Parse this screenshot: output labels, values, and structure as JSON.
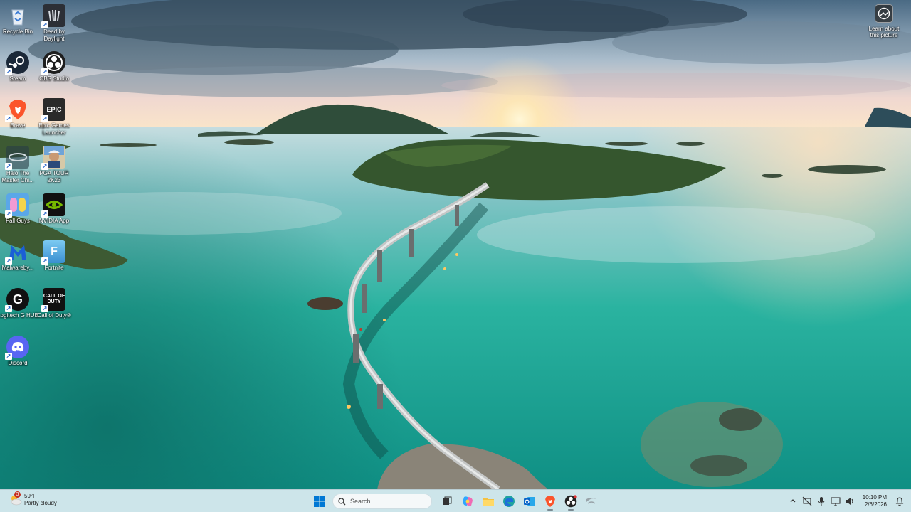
{
  "desktop": {
    "icons": [
      {
        "label": "Recycle Bin",
        "icon": "recycle-bin-icon"
      },
      {
        "label": "Dead by Daylight",
        "icon": "dead-by-daylight-icon"
      },
      {
        "label": "Steam",
        "icon": "steam-icon"
      },
      {
        "label": "OBS Studio",
        "icon": "obs-studio-icon"
      },
      {
        "label": "Brave",
        "icon": "brave-icon"
      },
      {
        "label": "Epic Games Launcher",
        "icon": "epic-games-icon",
        "tile_text": "EPIC"
      },
      {
        "label": "Halo The Master Chi...",
        "icon": "halo-icon"
      },
      {
        "label": "PGA TOUR 2K23",
        "icon": "pga-tour-icon"
      },
      {
        "label": "Fall Guys",
        "icon": "fall-guys-icon"
      },
      {
        "label": "NVIDIA App",
        "icon": "nvidia-icon"
      },
      {
        "label": "Malwareby...",
        "icon": "malwarebytes-icon"
      },
      {
        "label": "Fortnite",
        "icon": "fortnite-icon",
        "tile_text": "F"
      },
      {
        "label": "Logitech G HUB",
        "icon": "logitech-g-hub-icon",
        "tile_text": "G"
      },
      {
        "label": "Call of Duty®",
        "icon": "call-of-duty-icon",
        "tile_text": "CALL OF DUTY"
      },
      {
        "label": "Discord",
        "icon": "discord-icon"
      }
    ],
    "learn_picture": {
      "label": "Learn about this picture",
      "icon": "learn-about-picture-icon"
    }
  },
  "taskbar": {
    "weather": {
      "temp": "59°F",
      "condition": "Partly cloudy",
      "badge": "3",
      "icon": "weather-sun-cloud-icon"
    },
    "search": {
      "placeholder": "Search",
      "icon": "search-icon"
    },
    "pinned": [
      {
        "name": "start-button",
        "icon": "windows-logo-icon"
      },
      {
        "name": "task-view",
        "icon": "task-view-icon"
      },
      {
        "name": "copilot",
        "icon": "copilot-icon"
      },
      {
        "name": "file-explorer",
        "icon": "folder-icon"
      },
      {
        "name": "edge",
        "icon": "edge-icon"
      },
      {
        "name": "outlook",
        "icon": "outlook-icon"
      },
      {
        "name": "brave",
        "icon": "brave-icon"
      },
      {
        "name": "obs",
        "icon": "obs-studio-icon"
      },
      {
        "name": "steam",
        "icon": "steam-icon"
      }
    ],
    "tray": {
      "icons": [
        "chevron-up-icon",
        "network-off-icon",
        "microphone-icon",
        "display-icon",
        "volume-icon"
      ],
      "time": "10:10 PM",
      "date": "2/6/2026",
      "notification_icon": "notification-bell-icon"
    }
  },
  "colors": {
    "taskbar_bg": "#d4e8ee",
    "accent_blue": "#0067c0",
    "brave_orange": "#fb542b",
    "nvidia_green": "#76b900",
    "discord_blurple": "#5865f2"
  }
}
